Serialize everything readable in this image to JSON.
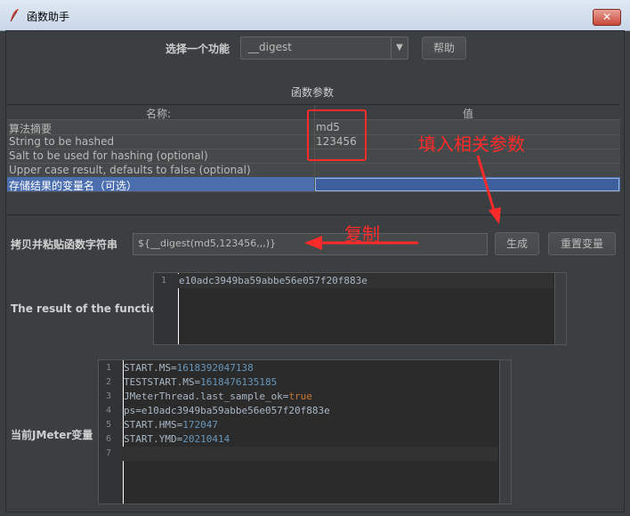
{
  "window": {
    "title": "函数助手",
    "close_icon": "close-icon"
  },
  "function_select": {
    "label": "选择一个功能",
    "value": "__digest",
    "help_button": "帮助"
  },
  "params": {
    "heading": "函数参数",
    "columns": [
      "名称:",
      "值"
    ],
    "rows": [
      {
        "name": "算法摘要",
        "value": "md5"
      },
      {
        "name": "String to be hashed",
        "value": "123456"
      },
      {
        "name": "Salt to be used for hashing (optional)",
        "value": ""
      },
      {
        "name": "Upper case result, defaults to false (optional)",
        "value": ""
      },
      {
        "name": "存储结果的变量名（可选）",
        "value": ""
      }
    ]
  },
  "function_string": {
    "label": "拷贝并粘贴函数字符串",
    "value": "${__digest(md5,123456,,,)}",
    "generate_button": "生成",
    "reset_button": "重置变量"
  },
  "result": {
    "label": "The result of the function is",
    "line_number": "1",
    "value": "e10adc3949ba59abbe56e057f20f883e"
  },
  "jmeter_vars": {
    "label": "当前JMeter变量",
    "lines": [
      {
        "n": "1",
        "key": "START.MS=",
        "val": "1618392047138",
        "type": "num"
      },
      {
        "n": "2",
        "key": "TESTSTART.MS=",
        "val": "1618476135185",
        "type": "num"
      },
      {
        "n": "3",
        "key": "JMeterThread.last_sample_ok=",
        "val": "true",
        "type": "kw"
      },
      {
        "n": "4",
        "key": "ps=e10adc3949ba59abbe56e057f20f883e",
        "val": "",
        "type": "plain"
      },
      {
        "n": "5",
        "key": "START.HMS=",
        "val": "172047",
        "type": "num"
      },
      {
        "n": "6",
        "key": "START.YMD=",
        "val": "20210414",
        "type": "num"
      },
      {
        "n": "7",
        "key": "",
        "val": "",
        "type": "plain"
      }
    ]
  },
  "annotations": {
    "fill_params": "填入相关参数",
    "copy": "复制",
    "color": "#ff2a2a"
  }
}
